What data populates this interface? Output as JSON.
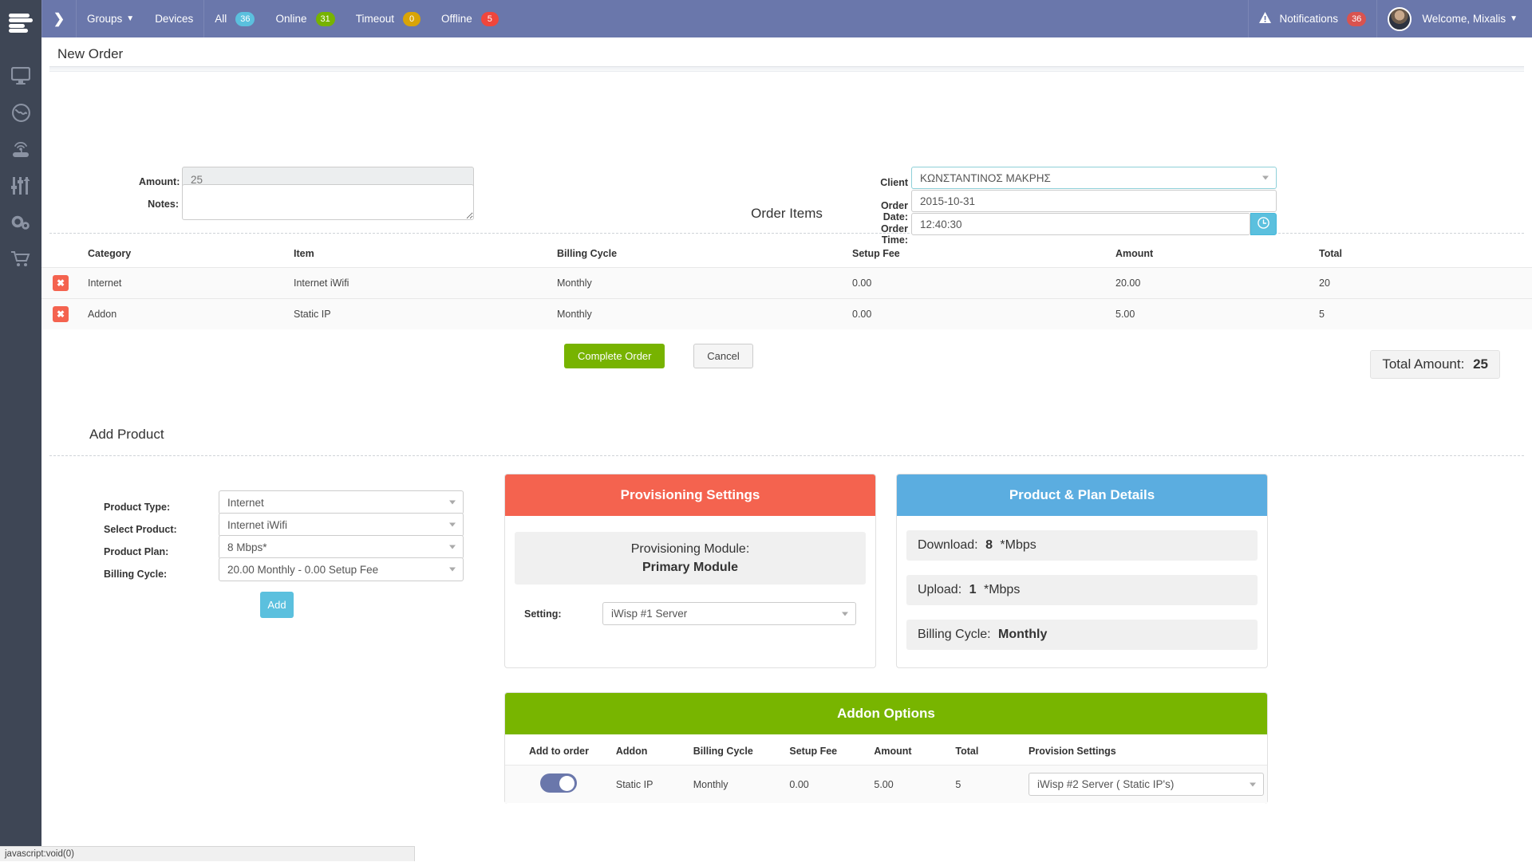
{
  "sidebar": {
    "logo_icon": "hamburger-logo-icon",
    "items": [
      {
        "icon": "monitor-icon",
        "name": "dashboard"
      },
      {
        "icon": "globe-icon",
        "name": "network"
      },
      {
        "icon": "wifi-router-icon",
        "name": "devices"
      },
      {
        "icon": "sliders-icon",
        "name": "settings-sliders"
      },
      {
        "icon": "gears-icon",
        "name": "configuration"
      },
      {
        "icon": "shopping-cart-icon",
        "name": "billing"
      }
    ]
  },
  "topbar": {
    "toggle_icon": "chevron-right-icon",
    "groups_label": "Groups",
    "groups_caret_icon": "caret-down-icon",
    "devices_label": "Devices",
    "status": [
      {
        "label": "All",
        "count": "36",
        "color": "#5bc0de"
      },
      {
        "label": "Online",
        "count": "31",
        "color": "#77b300"
      },
      {
        "label": "Timeout",
        "count": "0",
        "color": "#d9a406"
      },
      {
        "label": "Offline",
        "count": "5",
        "color": "#f0463c"
      }
    ],
    "notifications_icon": "warning-triangle-icon",
    "notifications_label": "Notifications",
    "notifications_count": "36",
    "notifications_badge_color": "#d9534f",
    "avatar_icon": "user-avatar",
    "welcome_label": "Welcome, Mixalis",
    "welcome_caret_icon": "caret-down-icon"
  },
  "new_order": {
    "title": "New Order",
    "amount_label": "Amount:",
    "amount_value": "25",
    "notes_label": "Notes:",
    "notes_value": "",
    "client_label": "Client",
    "client_value": "ΚΩΝΣΤΑΝΤΙΝΟΣ ΜΑΚΡΗΣ",
    "client_caret_icon": "caret-down-icon",
    "order_date_label": "Order Date:",
    "order_date_value": "2015-10-31",
    "order_time_label": "Order Time:",
    "order_time_value": "12:40:30",
    "time_picker_icon": "clock-icon"
  },
  "order_items": {
    "title": "Order Items",
    "columns": [
      "Category",
      "Item",
      "Billing Cycle",
      "Setup Fee",
      "Amount",
      "Total"
    ],
    "rows": [
      {
        "delete_icon": "remove-x-icon",
        "category": "Internet",
        "item": "Internet iWifi",
        "billing_cycle": "Monthly",
        "setup_fee": "0.00",
        "amount": "20.00",
        "total": "20"
      },
      {
        "delete_icon": "remove-x-icon",
        "category": "Addon",
        "item": "Static IP",
        "billing_cycle": "Monthly",
        "setup_fee": "0.00",
        "amount": "5.00",
        "total": "5"
      }
    ],
    "complete_label": "Complete Order",
    "cancel_label": "Cancel",
    "total_amount_label": "Total Amount:",
    "total_amount_value": "25"
  },
  "add_product": {
    "title": "Add Product",
    "fields": [
      {
        "label": "Product Type:",
        "value": "Internet",
        "name": "product-type"
      },
      {
        "label": "Select Product:",
        "value": "Internet iWifi",
        "name": "select-product"
      },
      {
        "label": "Product Plan:",
        "value": "8 Mbps*",
        "name": "product-plan"
      },
      {
        "label": "Billing Cycle:",
        "value": "20.00 Monthly - 0.00 Setup Fee",
        "name": "billing-cycle"
      }
    ],
    "add_label": "Add"
  },
  "provisioning": {
    "title": "Provisioning Settings",
    "module_label": "Provisioning Module:",
    "module_value": "Primary Module",
    "setting_label": "Setting:",
    "setting_value": "iWisp #1 Server",
    "caret_icon": "caret-down-icon"
  },
  "plan_details": {
    "title": "Product & Plan Details",
    "rows": [
      {
        "label": "Download:",
        "value": "8",
        "unit": "*Mbps"
      },
      {
        "label": "Upload:",
        "value": "1",
        "unit": "*Mbps"
      },
      {
        "label": "Billing Cycle:",
        "value": "Monthly",
        "unit": ""
      }
    ]
  },
  "addon_options": {
    "title": "Addon Options",
    "columns": [
      "Add to order",
      "Addon",
      "Billing Cycle",
      "Setup Fee",
      "Amount",
      "Total",
      "Provision Settings"
    ],
    "rows": [
      {
        "toggle_icon": "toggle-switch-on",
        "addon": "Static IP",
        "billing_cycle": "Monthly",
        "setup_fee": "0.00",
        "amount": "5.00",
        "total": "5",
        "provision_setting": "iWisp #2 Server ( Static IP's)",
        "caret_icon": "caret-down-icon"
      }
    ]
  },
  "statusbar": {
    "text": "javascript:void(0)"
  }
}
